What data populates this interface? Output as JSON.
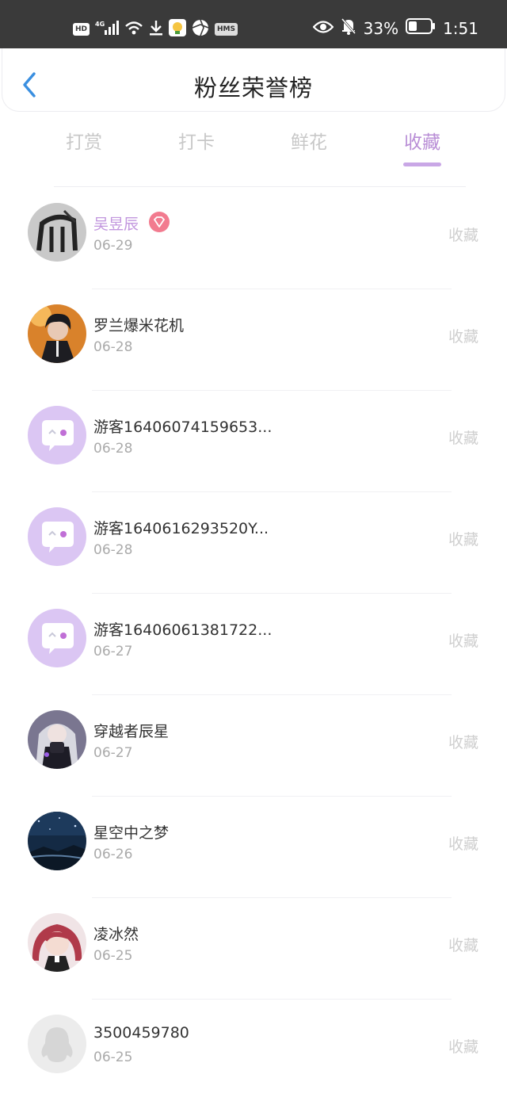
{
  "status_bar": {
    "hd": "HD",
    "network": "4G",
    "hms": "HMS",
    "battery": "33%",
    "time": "1:51"
  },
  "header": {
    "back_icon": "chevron-left-icon",
    "title": "粉丝荣誉榜"
  },
  "tabs": [
    {
      "label": "打赏"
    },
    {
      "label": "打卡"
    },
    {
      "label": "鲜花"
    },
    {
      "label": "收藏",
      "active": true
    }
  ],
  "colors": {
    "accent": "#b98ed6",
    "vip_name": "#c297de",
    "badge": "#f27b8f",
    "muted": "#cfcfcf"
  },
  "list": [
    {
      "name": "吴昱辰",
      "date": "06-29",
      "action": "收藏",
      "vip": true,
      "avatar": "ink-art-avatar"
    },
    {
      "name": "罗兰爆米花机",
      "date": "06-28",
      "action": "收藏",
      "avatar": "anime-boy-avatar"
    },
    {
      "name": "游客16406074159653...",
      "date": "06-28",
      "action": "收藏",
      "avatar": "guest-bubble-avatar"
    },
    {
      "name": "游客1640616293520Y...",
      "date": "06-28",
      "action": "收藏",
      "avatar": "guest-bubble-avatar"
    },
    {
      "name": "游客16406061381722...",
      "date": "06-27",
      "action": "收藏",
      "avatar": "guest-bubble-avatar"
    },
    {
      "name": "穿越者辰星",
      "date": "06-27",
      "action": "收藏",
      "avatar": "anime-girl-dark-avatar"
    },
    {
      "name": "星空中之梦",
      "date": "06-26",
      "action": "收藏",
      "avatar": "night-sky-avatar"
    },
    {
      "name": "凌冰然",
      "date": "06-25",
      "action": "收藏",
      "avatar": "anime-girl-red-avatar"
    },
    {
      "name": "3500459780",
      "date": "06-25",
      "action": "收藏",
      "avatar": "default-penguin-avatar"
    }
  ]
}
